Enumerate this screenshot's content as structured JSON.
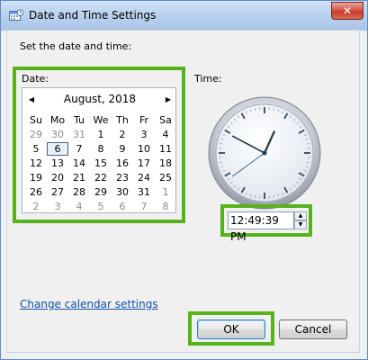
{
  "window": {
    "title": "Date and Time Settings",
    "close_label": "✕"
  },
  "instruction": "Set the date and time:",
  "date_label": "Date:",
  "time_label": "Time:",
  "calendar": {
    "month_title": "August, 2018",
    "prev_glyph": "◀",
    "next_glyph": "▶",
    "weekdays": [
      "Su",
      "Mo",
      "Tu",
      "We",
      "Th",
      "Fr",
      "Sa"
    ],
    "weeks": [
      [
        "29",
        "30",
        "31",
        "1",
        "2",
        "3",
        "4"
      ],
      [
        "5",
        "6",
        "7",
        "8",
        "9",
        "10",
        "11"
      ],
      [
        "12",
        "13",
        "14",
        "15",
        "16",
        "17",
        "18"
      ],
      [
        "19",
        "20",
        "21",
        "22",
        "23",
        "24",
        "25"
      ],
      [
        "26",
        "27",
        "28",
        "29",
        "30",
        "31",
        "1"
      ],
      [
        "2",
        "3",
        "4",
        "5",
        "6",
        "7",
        "8"
      ]
    ],
    "selected_day": "6"
  },
  "clock": {
    "hour": 12,
    "minute": 49,
    "second": 39
  },
  "time_value": "12:49:39 PM",
  "spin": {
    "up": "▲",
    "down": "▼"
  },
  "link_text": "Change calendar settings",
  "buttons": {
    "ok": "OK",
    "cancel": "Cancel"
  },
  "colors": {
    "highlight": "#57b31b",
    "link": "#0f4fa8"
  },
  "icons": {
    "app": "calendar-clock-icon",
    "close": "close-icon"
  }
}
